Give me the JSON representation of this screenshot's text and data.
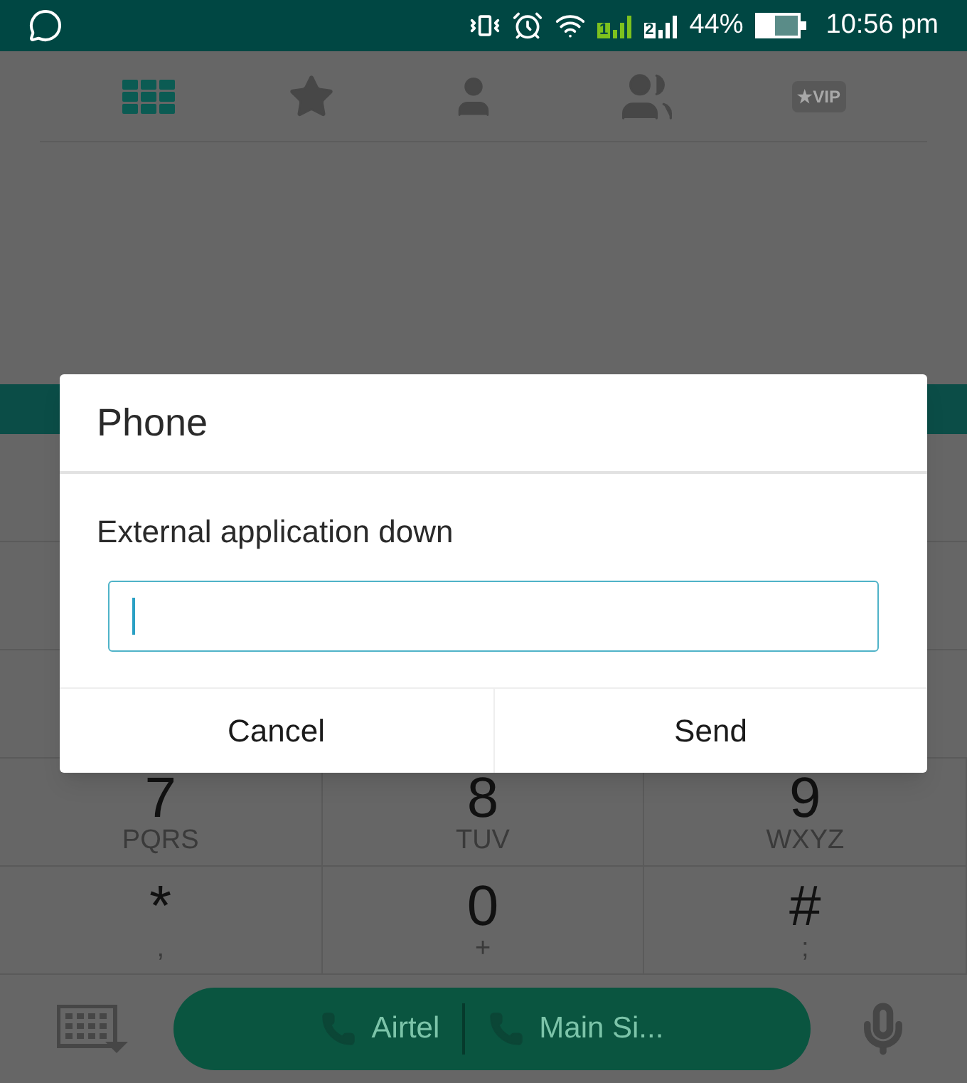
{
  "status_bar": {
    "sim_1": "1",
    "sim_2": "2",
    "battery": "44%",
    "time": "10:56 pm"
  },
  "tabs": [
    {
      "kind": "dialpad",
      "selected": true
    },
    {
      "kind": "favorites",
      "selected": false
    },
    {
      "kind": "contacts",
      "selected": false
    },
    {
      "kind": "groups",
      "selected": false
    },
    {
      "kind": "vip",
      "label": "★VIP",
      "selected": false
    }
  ],
  "keypad": [
    {
      "digit": "7",
      "letters": "PQRS"
    },
    {
      "digit": "8",
      "letters": "TUV"
    },
    {
      "digit": "9",
      "letters": "WXYZ"
    },
    {
      "digit": "*",
      "letters": ","
    },
    {
      "digit": "0",
      "letters": "+"
    },
    {
      "digit": "#",
      "letters": ";"
    }
  ],
  "call_buttons": [
    {
      "label": "Airtel"
    },
    {
      "label": "Main Si..."
    }
  ],
  "dialog": {
    "title": "Phone",
    "message": "External application down",
    "input": {
      "focused": true
    },
    "buttons": [
      "Cancel",
      "Send"
    ]
  }
}
